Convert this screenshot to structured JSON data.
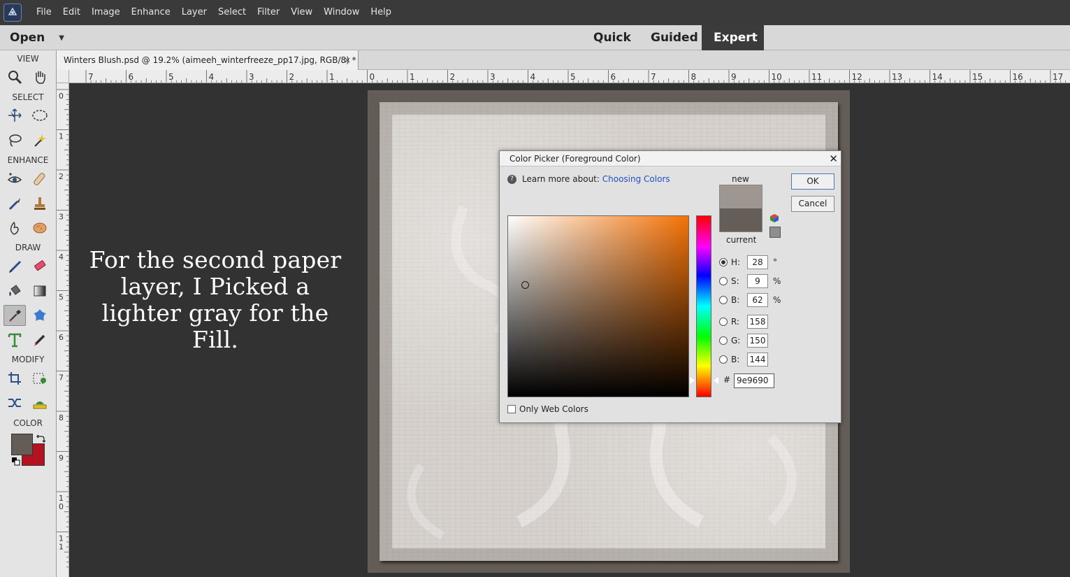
{
  "menubar": {
    "items": [
      "File",
      "Edit",
      "Image",
      "Enhance",
      "Layer",
      "Select",
      "Filter",
      "View",
      "Window",
      "Help"
    ],
    "logo_icon": "photoshop-elements-logo-icon"
  },
  "modebar": {
    "open_label": "Open",
    "tabs": [
      "Quick",
      "Guided",
      "Expert"
    ],
    "active_tab": "Expert"
  },
  "toolbox": {
    "sections": [
      "VIEW",
      "SELECT",
      "ENHANCE",
      "DRAW",
      "MODIFY",
      "COLOR"
    ],
    "tools": [
      "zoom-tool-icon",
      "hand-tool-icon",
      "move-tool-icon",
      "marquee-tool-icon",
      "lasso-tool-icon",
      "magic-wand-tool-icon",
      "red-eye-tool-icon",
      "spot-healing-tool-icon",
      "smart-brush-tool-icon",
      "clone-stamp-tool-icon",
      "blur-tool-icon",
      "sponge-tool-icon",
      "brush-tool-icon",
      "eraser-tool-icon",
      "paint-bucket-tool-icon",
      "gradient-tool-icon",
      "eyedropper-tool-icon",
      "custom-shape-tool-icon",
      "type-tool-icon",
      "pencil-tool-icon",
      "crop-tool-icon",
      "recompose-tool-icon",
      "content-aware-move-tool-icon",
      "straighten-tool-icon"
    ],
    "selected_tool": "eyedropper-tool-icon",
    "foreground_color": "#645c56",
    "background_color": "#b5121f"
  },
  "document": {
    "tab_title": "Winters Blush.psd @ 19.2% (aimeeh_winterfreeze_pp17.jpg, RGB/8) *",
    "close_glyph": "×"
  },
  "rulers": {
    "top_labels": [
      "7",
      "6",
      "5",
      "4",
      "3",
      "2",
      "1",
      "0",
      "1",
      "2",
      "3",
      "4",
      "5",
      "6",
      "7",
      "8",
      "9",
      "10",
      "11",
      "12",
      "13",
      "14",
      "15",
      "16",
      "17"
    ],
    "left_labels": [
      "0",
      "1",
      "2",
      "3",
      "4",
      "5",
      "6",
      "7",
      "8",
      "9",
      "1\n0",
      "1\n1"
    ]
  },
  "caption": {
    "text": "For the second paper layer, I Picked a lighter gray for the Fill."
  },
  "color_picker": {
    "title": "Color Picker (Foreground Color)",
    "learn_prefix": "Learn more about:",
    "learn_link": "Choosing Colors",
    "new_label": "new",
    "current_label": "current",
    "new_color": "#9e9690",
    "current_color": "#645d58",
    "ok_label": "OK",
    "cancel_label": "Cancel",
    "fields": [
      {
        "label": "H:",
        "value": "28",
        "unit": "°",
        "selected": true
      },
      {
        "label": "S:",
        "value": "9",
        "unit": "%",
        "selected": false
      },
      {
        "label": "B:",
        "value": "62",
        "unit": "%",
        "selected": false
      },
      {
        "label": "R:",
        "value": "158",
        "unit": "",
        "selected": false
      },
      {
        "label": "G:",
        "value": "150",
        "unit": "",
        "selected": false
      },
      {
        "label": "B:",
        "value": "144",
        "unit": "",
        "selected": false
      }
    ],
    "hex_label": "#",
    "hex_value": "9e9690",
    "only_web_colors_label": "Only Web Colors",
    "only_web_colors_checked": false
  }
}
